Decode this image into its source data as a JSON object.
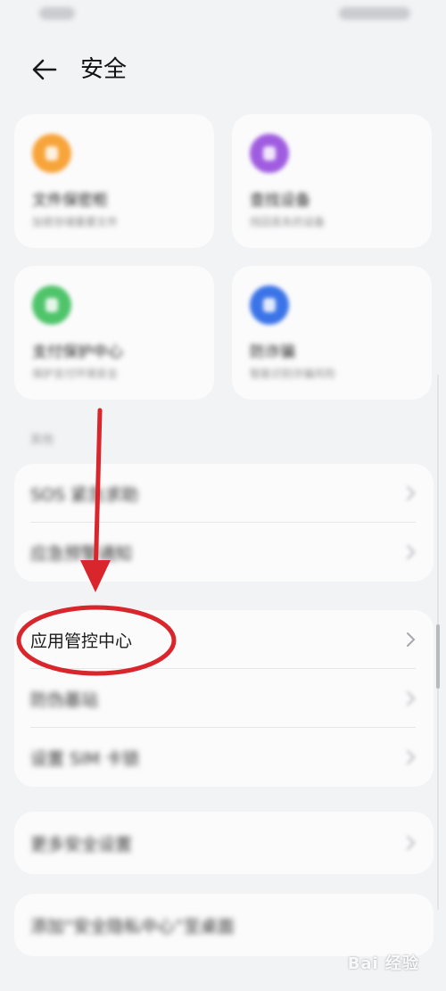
{
  "header": {
    "title": "安全"
  },
  "tiles": [
    {
      "title": "文件保密柜",
      "subtitle": "加密存储重要文件",
      "color": "#f7a43a"
    },
    {
      "title": "查找设备",
      "subtitle": "找回丢失的设备",
      "color": "#a05ce0"
    },
    {
      "title": "支付保护中心",
      "subtitle": "保护支付环境安全",
      "color": "#4fc46a"
    },
    {
      "title": "防诈骗",
      "subtitle": "智能识别诈骗风险",
      "color": "#3b74e8"
    }
  ],
  "section_label": "其他",
  "list_groups": [
    [
      {
        "label": "SOS 紧急求助"
      },
      {
        "label": "应急预警通知"
      }
    ],
    [
      {
        "label": "应用管控中心"
      },
      {
        "label": "防伪基站"
      },
      {
        "label": "设置 SIM 卡锁"
      }
    ],
    [
      {
        "label": "更多安全设置"
      }
    ],
    [
      {
        "label": "添加“安全隐私中心”至桌面"
      }
    ]
  ],
  "annotation": {
    "color": "#d9262c"
  },
  "watermark": "Bai 经验"
}
